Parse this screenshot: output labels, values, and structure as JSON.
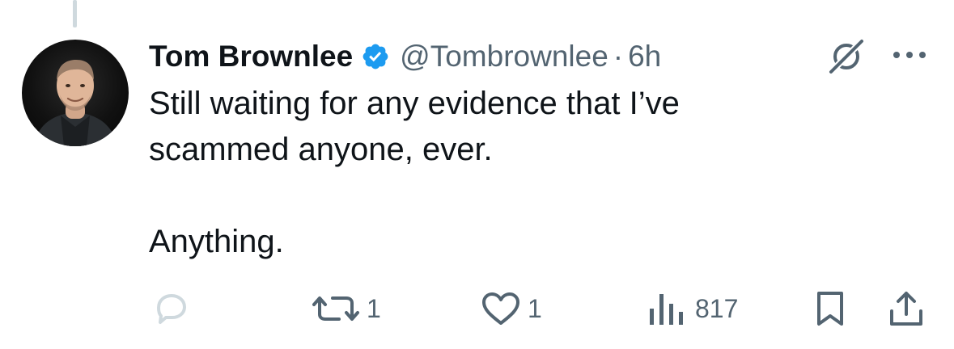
{
  "tweet": {
    "display_name": "Tom Brownlee",
    "handle": "@Tombrownlee",
    "separator": "·",
    "time": "6h",
    "text": "Still waiting for any evidence that I’ve\nscammed anyone, ever.\n\nAnything."
  },
  "actions": {
    "reply_count": "",
    "retweet_count": "1",
    "like_count": "1",
    "views_count": "817"
  },
  "icons": {
    "verified": "verified-badge-icon",
    "grok": "grok-icon",
    "more": "more-icon",
    "reply": "reply-icon",
    "retweet": "retweet-icon",
    "like": "heart-icon",
    "views": "views-icon",
    "bookmark": "bookmark-icon",
    "share": "share-icon"
  },
  "colors": {
    "verified": "#1d9bf0",
    "text": "#0f1419",
    "secondary": "#536471",
    "thread_line": "#cfd9de"
  }
}
